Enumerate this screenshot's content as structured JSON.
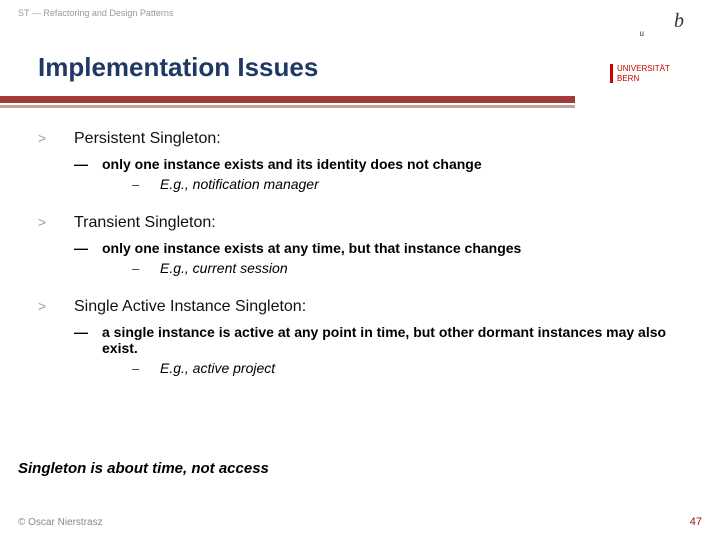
{
  "header": {
    "breadcrumb": "ST — Refactoring and Design Patterns",
    "title": "Implementation Issues"
  },
  "logo": {
    "b": "b",
    "u": "u",
    "line1": "UNIVERSITÄT",
    "line2": "BERN"
  },
  "items": [
    {
      "bullet": ">",
      "title": "Persistent Singleton:",
      "dash": "—",
      "desc": "only one instance exists and its identity does not change",
      "endash": "–",
      "eg": "E.g., notification manager"
    },
    {
      "bullet": ">",
      "title": "Transient Singleton:",
      "dash": "—",
      "desc": "only one instance exists at any time, but that instance changes",
      "endash": "–",
      "eg": "E.g., current session"
    },
    {
      "bullet": ">",
      "title": "Single Active Instance Singleton:",
      "dash": "—",
      "desc": "a single instance is active at any point in time, but other dormant instances may also exist.",
      "endash": "–",
      "eg": "E.g., active project"
    }
  ],
  "conclusion": "Singleton is about time, not access",
  "footer": {
    "copyright": "© Oscar Nierstrasz",
    "page": "47"
  }
}
